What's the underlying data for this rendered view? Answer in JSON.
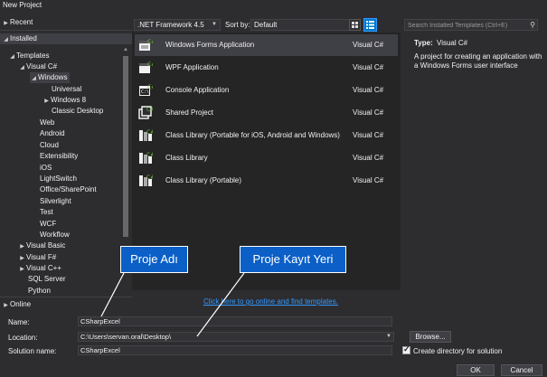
{
  "window": {
    "title": "New Project"
  },
  "tree": {
    "recent": "Recent",
    "installed": "Installed",
    "templates": "Templates",
    "visual_csharp": "Visual C#",
    "windows": "Windows",
    "universal": "Universal",
    "windows8": "Windows 8",
    "classic_desktop": "Classic Desktop",
    "web": "Web",
    "android": "Android",
    "cloud": "Cloud",
    "extensibility": "Extensibility",
    "ios": "iOS",
    "lightswitch": "LightSwitch",
    "office_sharepoint": "Office/SharePoint",
    "silverlight": "Silverlight",
    "test": "Test",
    "wcf": "WCF",
    "workflow": "Workflow",
    "visual_basic": "Visual Basic",
    "visual_fsharp": "Visual F#",
    "visual_cpp": "Visual C++",
    "sql_server": "SQL Server",
    "python": "Python",
    "online": "Online"
  },
  "toolbar": {
    "framework": ".NET Framework 4.5",
    "sort_by_label": "Sort by:",
    "sort_by_value": "Default"
  },
  "templates": [
    {
      "name": "Windows Forms Application",
      "lang": "Visual C#",
      "icon": "windows-forms-icon"
    },
    {
      "name": "WPF Application",
      "lang": "Visual C#",
      "icon": "wpf-icon"
    },
    {
      "name": "Console Application",
      "lang": "Visual C#",
      "icon": "console-icon"
    },
    {
      "name": "Shared Project",
      "lang": "Visual C#",
      "icon": "shared-project-icon"
    },
    {
      "name": "Class Library (Portable for iOS, Android and Windows)",
      "lang": "Visual C#",
      "icon": "class-library-icon"
    },
    {
      "name": "Class Library",
      "lang": "Visual C#",
      "icon": "class-library-icon"
    },
    {
      "name": "Class Library (Portable)",
      "lang": "Visual C#",
      "icon": "class-library-icon"
    }
  ],
  "search": {
    "placeholder": "Search Installed Templates (Ctrl+E)"
  },
  "details": {
    "type_label": "Type:",
    "type_value": "Visual C#",
    "description": "A project for creating an application with a Windows Forms user interface"
  },
  "online_link": "Click here to go online and find templates.",
  "form": {
    "name_label": "Name:",
    "name_value": "CSharpExcel",
    "location_label": "Location:",
    "location_value": "C:\\Users\\servan.oral\\Desktop\\",
    "solution_label": "Solution name:",
    "solution_value": "CSharpExcel",
    "browse_label": "Browse...",
    "create_dir_label": "Create directory for solution",
    "create_dir_checked": true,
    "ok_label": "OK",
    "cancel_label": "Cancel"
  },
  "annotations": {
    "project_name": "Proje Adı",
    "project_location": "Proje Kayıt Yeri"
  },
  "colors": {
    "background": "#2d2d30",
    "list_background": "#252526",
    "selection": "#3f3f46",
    "accent": "#007acc",
    "link": "#3399ff",
    "callout": "#0b5fc7"
  }
}
